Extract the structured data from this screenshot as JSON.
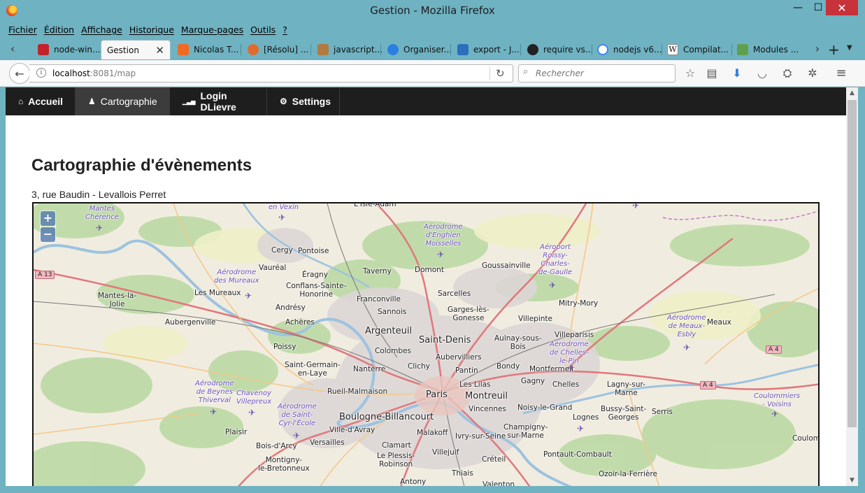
{
  "window": {
    "title": "Gestion - Mozilla Firefox",
    "minimize": "—",
    "maximize": "☐",
    "close": "✕"
  },
  "menu": [
    "Fichier",
    "Édition",
    "Affichage",
    "Historique",
    "Marque-pages",
    "Outils",
    "?"
  ],
  "tabs": [
    {
      "label": "node-win...",
      "color": "#c3242b"
    },
    {
      "label": "Gestion",
      "color": ""
    },
    {
      "label": "Nicolas T...",
      "color": "#f06a22"
    },
    {
      "label": "[Résolu] ...",
      "color": "#e06b2f"
    },
    {
      "label": "javascript...",
      "color": "#b07a40"
    },
    {
      "label": "Organiser...",
      "color": "#2b7fe0"
    },
    {
      "label": "export - J...",
      "color": "#2c6fbd"
    },
    {
      "label": "require vs...",
      "color": "#222222"
    },
    {
      "label": "nodejs v6...",
      "color": "#4285f4"
    },
    {
      "label": "Compilat...",
      "color": "#ffffff"
    },
    {
      "label": "Modules ...",
      "color": "#5fa04e"
    }
  ],
  "url": {
    "host": "localhost",
    "path": ":8081/map"
  },
  "search": {
    "placeholder": "Rechercher"
  },
  "appnav": [
    {
      "label": "Accueil",
      "icon": "⌂"
    },
    {
      "label": "Cartographie",
      "icon": "♟"
    },
    {
      "label": "Login DLievre",
      "icon": "▁▃▅"
    },
    {
      "label": "Settings",
      "icon": "⚙"
    }
  ],
  "page": {
    "title": "Cartographie d'évènements",
    "address": "3, rue Baudin - Levallois Perret"
  },
  "map": {
    "zoom_in": "+",
    "zoom_out": "−",
    "labels": {
      "paris": "Paris",
      "saint_denis": "Saint-Denis",
      "argenteuil": "Argenteuil",
      "montreuil": "Montreuil",
      "boulogne": "Boulogne-Billancourt",
      "cergy": "Cergy",
      "pontoise": "Pontoise",
      "vaureal": "Vauréal",
      "eragny": "Éragny",
      "conflans": "Conflans-Sainte-\nHonorine",
      "les_mureaux": "Les Mureaux",
      "mantes": "Mantes-la-\nJolie",
      "aubergenville": "Aubergenville",
      "andresy": "Andrésy",
      "acheres": "Achères",
      "poissy": "Poissy",
      "st_germain": "Saint-Germain-\nen-Laye",
      "nanterre": "Nanterre",
      "rueil": "Rueil-Malmaison",
      "plaisir": "Plaisir",
      "bois_arcy": "Bois-d'Arcy",
      "versailles": "Versailles",
      "ville_avray": "Ville-d'Avray",
      "montigny": "Montigny-\nle-Bretonneux",
      "taverny": "Taverny",
      "domont": "Domont",
      "franconville": "Franconville",
      "sannois": "Sannois",
      "sarcelles": "Sarcelles",
      "garges": "Garges-lès-\nGonesse",
      "goussainville": "Goussainville",
      "villepinte": "Villepinte",
      "mitry": "Mitry-Mory",
      "aulnay": "Aulnay-sous-\nBois",
      "villeparisis": "Villeparisis",
      "colombes": "Colombes",
      "aubervilliers": "Aubervilliers",
      "clichy": "Clichy",
      "pantin": "Pantin",
      "bondy": "Bondy",
      "montfermeil": "Montfermeil",
      "les_lilas": "Les Lilas",
      "gagny": "Gagny",
      "chelles": "Chelles",
      "lagny": "Lagny-sur-\nMarne",
      "bussy": "Bussy-Saint-\nGeorges",
      "serris": "Serris",
      "meaux": "Meaux",
      "vincennes": "Vincennes",
      "noisy": "Noisy-le-Grand",
      "malakoff": "Malakoff",
      "ivry": "Ivry-sur-Seine",
      "champigny": "Champigny-\nsur-Marne",
      "lognes": "Lognes",
      "pontault": "Pontault-Combault",
      "clamart": "Clamart",
      "plessis": "Le Plessis-\nRobinson",
      "villejuif": "Villejuif",
      "creteil": "Créteil",
      "thiais": "Thiais",
      "antony": "Antony",
      "valenton": "Valenton",
      "ozoir": "Ozoir-la-Ferrière",
      "coulommiers_v": "Coulomm",
      "isle_adam": "L'Isle-Adam",
      "aero_enghien": "Aérodrome\nd'Enghien\nMoisselles",
      "aero_roissy": "Aéroport\nRoissy-\nCharles-\nde-Gaulle",
      "aero_mureaux": "Aérodrome\ndes Mureaux",
      "aero_chelles": "Aérodrome\nde Chelles-\nle-Pin",
      "aero_meaux": "Aérodrome\nde Meaux-\nEsbly",
      "aero_beynes": "Aérodrome\nde Beynes\nThiverval",
      "chavenoy": "Chavenoy\nVillepreux",
      "aero_stcyr": "Aérodrome\nde Saint-\nCyr-l'École",
      "coulommiers": "Coulommiers\n- Voisins",
      "mantes_cherence": "Mantes\nChérence",
      "en_vexin": "en Vexin",
      "a13": "A 13",
      "a4": "A 4",
      "a4b": "A 4"
    }
  }
}
